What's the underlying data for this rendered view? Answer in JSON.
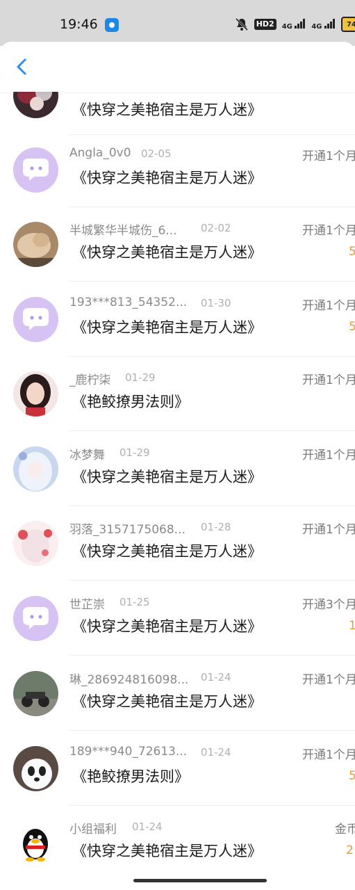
{
  "status_bar": {
    "time": "19:46",
    "hd_label": "HD2",
    "net1": "4G",
    "net2": "4G",
    "battery": "74"
  },
  "header": {
    "back_icon": "chevron-left-icon",
    "accent_color": "#2b8ff0"
  },
  "rows": [
    {
      "avatar": "anime-avatar",
      "name": "",
      "date": "",
      "title": "《快穿之美艳宿主是万人迷》",
      "action": "",
      "amount": ""
    },
    {
      "avatar": "default-chat-avatar",
      "name": "Angla_0v0",
      "date": "02-05",
      "title": "《快穿之美艳宿主是万人迷》",
      "action": "开通1个月",
      "amount": ""
    },
    {
      "avatar": "photo-avatar",
      "name": "半城繁华半城伤_6...",
      "date": "02-02",
      "title": "《快穿之美艳宿主是万人迷》",
      "action": "开通1个月",
      "amount": "5"
    },
    {
      "avatar": "default-chat-avatar",
      "name": "193***813_54352...",
      "date": "01-30",
      "title": "《快穿之美艳宿主是万人迷》",
      "action": "开通1个月",
      "amount": "5"
    },
    {
      "avatar": "girl-photo-avatar",
      "name": "_鹿柠柒",
      "date": "01-29",
      "title": "《艳鲛撩男法则》",
      "action": "开通1个月",
      "amount": ""
    },
    {
      "avatar": "anime-girl-avatar",
      "name": "冰梦舞",
      "date": "01-29",
      "title": "《快穿之美艳宿主是万人迷》",
      "action": "开通1个月",
      "amount": ""
    },
    {
      "avatar": "anime-flower-avatar",
      "name": "羽落_3157175068...",
      "date": "01-28",
      "title": "《快穿之美艳宿主是万人迷》",
      "action": "开通1个月",
      "amount": ""
    },
    {
      "avatar": "default-chat-avatar",
      "name": "世芷崇",
      "date": "01-25",
      "title": "《快穿之美艳宿主是万人迷》",
      "action": "开通3个月",
      "amount": "1"
    },
    {
      "avatar": "motorbike-avatar",
      "name": "琳_286924816098...",
      "date": "01-24",
      "title": "《快穿之美艳宿主是万人迷》",
      "action": "开通1个月",
      "amount": ""
    },
    {
      "avatar": "panda-avatar",
      "name": "189***940_72613...",
      "date": "01-24",
      "title": "《艳鲛撩男法则》",
      "action": "开通1个月",
      "amount": "5"
    },
    {
      "avatar": "penguin-avatar",
      "name": "小组福利",
      "date": "01-24",
      "title": "《快穿之美艳宿主是万人迷》",
      "action": "金币",
      "amount": "2"
    }
  ],
  "colors": {
    "default_avatar_bg": "#d6c3f3",
    "amount": "#e69a3a"
  }
}
